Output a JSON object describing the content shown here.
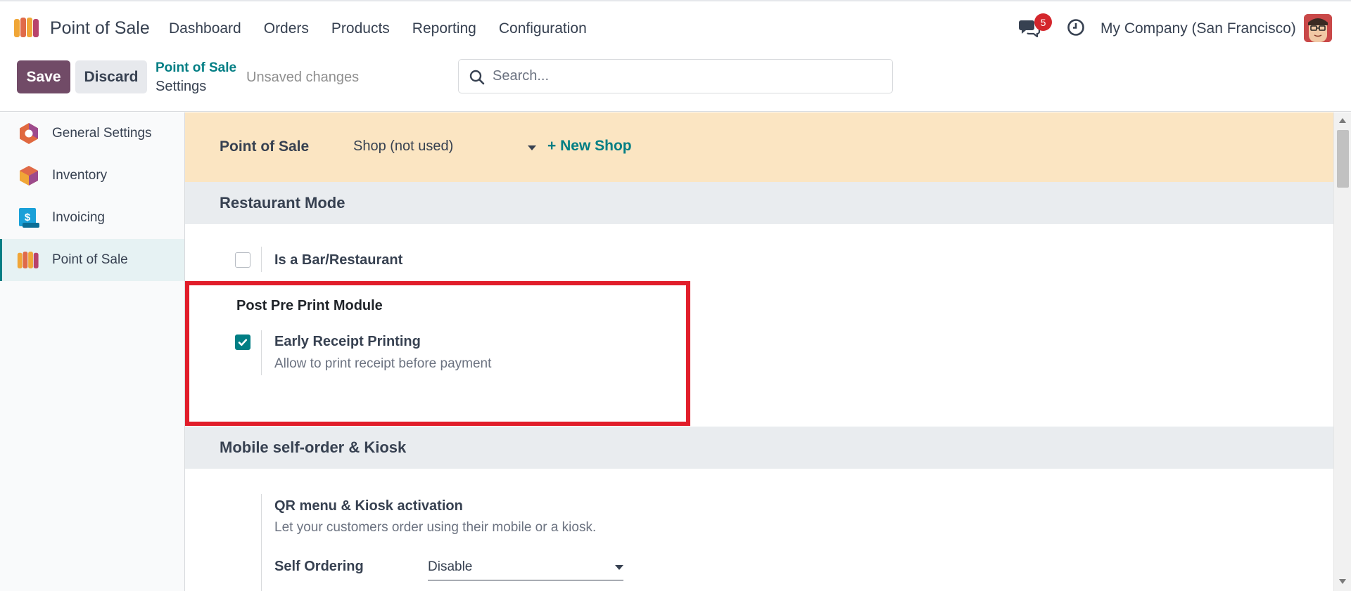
{
  "navbar": {
    "app_name": "Point of Sale",
    "menu": [
      "Dashboard",
      "Orders",
      "Products",
      "Reporting",
      "Configuration"
    ],
    "chat_count": "5",
    "company": "My Company (San Francisco)"
  },
  "control": {
    "save_label": "Save",
    "discard_label": "Discard",
    "breadcrumb_parent": "Point of Sale",
    "breadcrumb_current": "Settings",
    "unsaved": "Unsaved changes",
    "search_placeholder": "Search..."
  },
  "sidebar": {
    "items": [
      {
        "label": "General Settings",
        "icon": "general-settings-icon"
      },
      {
        "label": "Inventory",
        "icon": "inventory-icon"
      },
      {
        "label": "Invoicing",
        "icon": "invoicing-icon"
      },
      {
        "label": "Point of Sale",
        "icon": "point-of-sale-icon",
        "active": true
      }
    ]
  },
  "main": {
    "pos_label": "Point of Sale",
    "shop_value": "Shop (not used)",
    "new_shop": "+ New Shop",
    "restaurant_section": "Restaurant Mode",
    "bar_restaurant": {
      "label": "Is a Bar/Restaurant",
      "checked": false
    },
    "module_title": "Post Pre Print Module",
    "early_receipt": {
      "title": "Early Receipt Printing",
      "desc": "Allow to print receipt before payment",
      "checked": true
    },
    "kiosk_section": "Mobile self-order & Kiosk",
    "qr_title": "QR menu & Kiosk activation",
    "qr_desc": "Let your customers order using their mobile or a kiosk.",
    "self_ordering_label": "Self Ordering",
    "self_ordering_value": "Disable"
  },
  "colors": {
    "brand": "#714b67",
    "accent": "#017e84",
    "highlight": "#e11d2a",
    "banner": "#fbe5c2"
  }
}
